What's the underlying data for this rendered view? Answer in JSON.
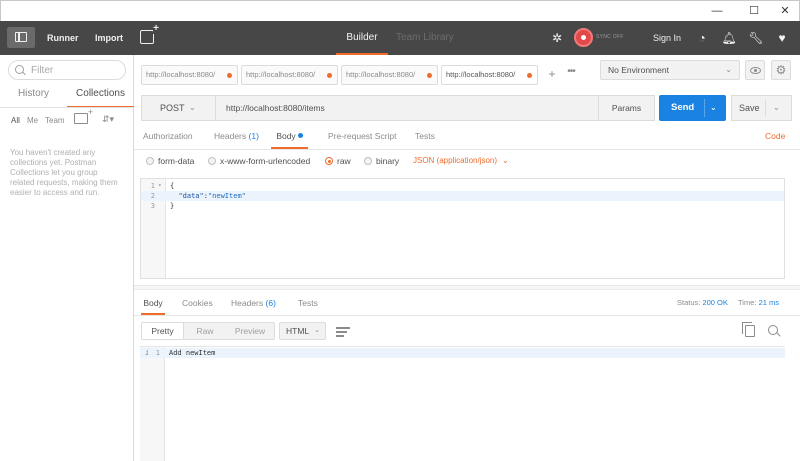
{
  "window": {
    "minimize": "—",
    "maximize": "☐",
    "close": "✕"
  },
  "header": {
    "runner": "Runner",
    "import": "Import",
    "nav_builder": "Builder",
    "nav_team_library": "Team Library",
    "sync_status": "SYNC OFF",
    "sign_in": "Sign In",
    "icons": [
      "sidebar-toggle-icon",
      "new-tab-icon",
      "interceptor-icon",
      "sync-icon",
      "radar-icon",
      "bell-icon",
      "wrench-icon",
      "heart-icon"
    ]
  },
  "sidebar": {
    "filter_placeholder": "Filter",
    "tabs": [
      "History",
      "Collections"
    ],
    "active_tab": "Collections",
    "filters": [
      "All",
      "Me",
      "Team"
    ],
    "empty_message": "You haven't created any collections yet. Postman Collections let you group related requests, making them easier to access and run."
  },
  "tabs": [
    {
      "label": "http://localhost:8080/",
      "unsaved": true
    },
    {
      "label": "http://localhost:8080/",
      "unsaved": true
    },
    {
      "label": "http://localhost:8080/",
      "unsaved": true
    },
    {
      "label": "http://localhost:8080/",
      "unsaved": true,
      "active": true
    }
  ],
  "tab_add": "+",
  "tab_more": "•••",
  "environment": {
    "selected": "No Environment"
  },
  "request": {
    "method": "POST",
    "url": "http://localhost:8080/items",
    "params_label": "Params",
    "send_label": "Send",
    "save_label": "Save"
  },
  "request_tabs": {
    "authorization": "Authorization",
    "headers": "Headers",
    "headers_count": "(1)",
    "body": "Body",
    "pre_request": "Pre-request Script",
    "tests": "Tests",
    "code": "Code"
  },
  "body_types": {
    "form_data": "form-data",
    "urlencoded": "x-www-form-urlencoded",
    "raw": "raw",
    "binary": "binary",
    "selected": "raw",
    "content_type": "JSON (application/json)"
  },
  "editor": {
    "lines": [
      {
        "num": "1",
        "text": "{"
      },
      {
        "num": "2",
        "key": "\"data\"",
        "sep": ":",
        "val": "\"newItem\""
      },
      {
        "num": "3",
        "text": "}"
      }
    ]
  },
  "response": {
    "tabs": {
      "body": "Body",
      "cookies": "Cookies",
      "headers": "Headers",
      "headers_count": "(6)",
      "tests": "Tests"
    },
    "status_label": "Status:",
    "status_value": "200 OK",
    "time_label": "Time:",
    "time_value": "21 ms",
    "views": [
      "Pretty",
      "Raw",
      "Preview"
    ],
    "active_view": "Pretty",
    "format": "HTML",
    "line_num": "1",
    "line_info": "i",
    "line_text": "Add newItem"
  },
  "colors": {
    "accent": "#ef6c2c",
    "send_blue": "#1a82e2",
    "header_bg": "#474747",
    "sync_red": "#e24a4a"
  }
}
